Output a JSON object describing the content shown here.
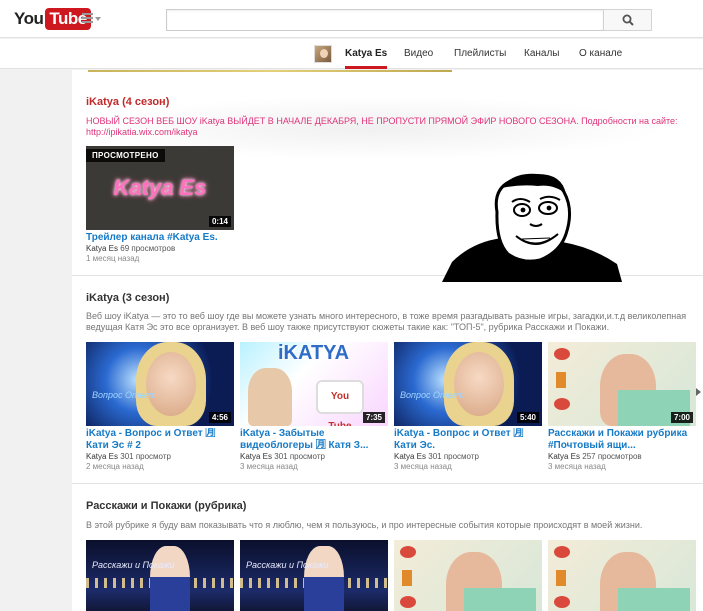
{
  "masthead": {
    "logo_you": "You",
    "logo_tube": "Tube",
    "search_value": "",
    "search_placeholder": ""
  },
  "channel_nav": {
    "channel_name": "Katya Es",
    "tabs": [
      "Видео",
      "Плейлисты",
      "Каналы",
      "О канале"
    ]
  },
  "sections": [
    {
      "title": "iKatya (4 сезон)",
      "description": "НОВЫЙ СЕЗОН ВЕБ ШОУ iKatya ВЫЙДЕТ В НАЧАЛЕ ДЕКАБРЯ, НЕ ПРОПУСТИ ПРЯМОЙ ЭФИР НОВОГО СЕЗОНА. Подробности на сайте: http://ipikatia.wix.com/ikatya",
      "videos": [
        {
          "badge": "ПРОСМОТРЕНО",
          "thumb_text": "Katya Es",
          "duration": "0:14",
          "title": "Трейлер канала #Katya Es.",
          "owner": "Katya Es",
          "views": "69 просмотров",
          "date": "1 месяц назад"
        }
      ]
    },
    {
      "title": "iKatya (3 сезон)",
      "description": "Веб шоу iKatya — это то веб шоу где вы можете узнать много интересного, в тоже время разгадывать разные игры, загадки,и.т.д великолепная ведущая Катя Эс это все организует. В веб шоу также присутствуют сюжеты такие как: \"ТОП-5\", рубрика Расскажи и Покажи.",
      "videos": [
        {
          "thumb_text": "Вопрос Ответ",
          "duration": "4:56",
          "title": "iKatya - Вопрос и Ответ 🈷 Кати Эс # 2",
          "owner": "Katya Es",
          "views": "301 просмотр",
          "date": "2 месяца назад"
        },
        {
          "thumb_text": "iKATYA",
          "thumb_text_2": "You Tube",
          "duration": "7:35",
          "title": "iKatya - Забытые видеоблогеры 🈷 Катя З...",
          "owner": "Katya Es",
          "views": "301 просмотр",
          "date": "3 месяца назад"
        },
        {
          "thumb_text": "Вопрос Ответ",
          "duration": "5:40",
          "title": "iKatya - Вопрос и Ответ 🈷 Кати Эс.",
          "owner": "Katya Es",
          "views": "301 просмотр",
          "date": "3 месяца назад"
        },
        {
          "duration": "7:00",
          "title": "Расскажи и Покажи рубрика #Почтовый ящи...",
          "owner": "Katya Es",
          "views": "257 просмотров",
          "date": "3 месяца назад"
        }
      ]
    },
    {
      "title": "Расскажи и Покажи (рубрика)",
      "description": "В этой рубрике я буду вам показывать что я люблю, чем я пользуюсь, и про интересные события которые происходят в моей жизни.",
      "videos": [
        {
          "thumb_text": "Расскажи и Покажи"
        },
        {
          "thumb_text": "Расскажи и Покажи"
        },
        {},
        {}
      ]
    }
  ],
  "colors": {
    "youtube_red": "#cc181e",
    "link_blue": "#167ac6",
    "section_title_red": "#c02a2a",
    "promo_pink": "#e0337a"
  }
}
